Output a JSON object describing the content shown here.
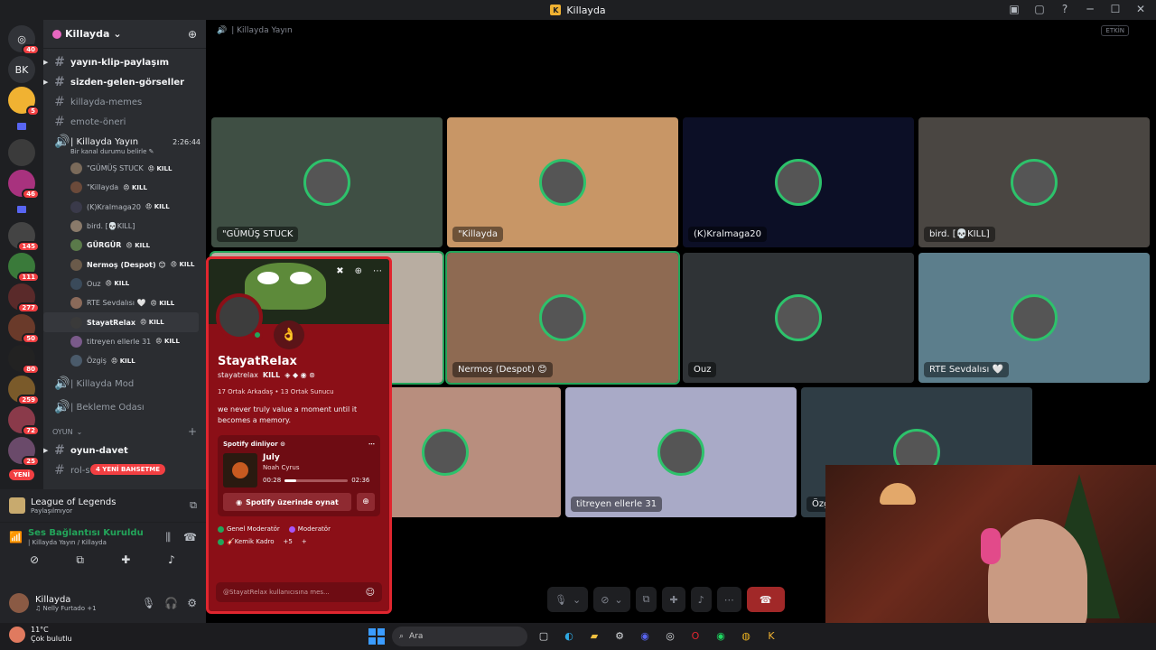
{
  "window": {
    "title": "Killayda",
    "controls": [
      "▣",
      "▢",
      "?",
      "─",
      "☐",
      "✕"
    ]
  },
  "rail": {
    "servers": [
      {
        "label": "◎",
        "badge": "40"
      },
      {
        "label": "BK",
        "badge": ""
      },
      {
        "label": "",
        "badge": "5",
        "color": "#f0b232"
      },
      {
        "label": "",
        "badge": "",
        "folder": true
      },
      {
        "label": "",
        "badge": "",
        "color": "#3b3b3b"
      },
      {
        "label": "",
        "badge": "46",
        "color": "#a8327e"
      },
      {
        "label": "",
        "badge": "",
        "folder": true
      },
      {
        "label": "",
        "badge": "145",
        "color": "#444"
      },
      {
        "label": "",
        "badge": "111",
        "color": "#3a7a3a"
      },
      {
        "label": "",
        "badge": "277",
        "color": "#5a2a2a"
      },
      {
        "label": "",
        "badge": "50",
        "color": "#6a3a2a"
      },
      {
        "label": "",
        "badge": "80",
        "color": "#222"
      },
      {
        "label": "",
        "badge": "259",
        "color": "#7a5a2a"
      },
      {
        "label": "",
        "badge": "72",
        "color": "#8a3a4a"
      },
      {
        "label": "",
        "badge": "25",
        "color": "#6a4a6a"
      }
    ],
    "new_label": "YENİ"
  },
  "guild": {
    "name": "Killayda",
    "channels": [
      {
        "name": "yayın-klip-paylaşım",
        "bold": true,
        "arrow": true
      },
      {
        "name": "sizden-gelen-görseller",
        "bold": true,
        "arrow": true
      },
      {
        "name": "killayda-memes",
        "bold": false
      },
      {
        "name": "emote-öneri",
        "bold": false
      }
    ],
    "voice_channel": {
      "name": "| Killayda Yayın",
      "time": "2:26:44",
      "status": "Bir kanal durumu belirle ✎"
    },
    "voice_users": [
      {
        "name": "\"GÜMÜŞ STUCK",
        "tag": "KILL",
        "bold": false
      },
      {
        "name": "\"Killayda",
        "tag": "KILL",
        "bold": false
      },
      {
        "name": "(K)Kralmaga20",
        "tag": "KILL",
        "bold": false
      },
      {
        "name": "bird. [💀KILL]",
        "tag": "",
        "bold": false
      },
      {
        "name": "GÜRGÜR",
        "tag": "KILL",
        "bold": true
      },
      {
        "name": "Nermoş (Despot) 😊",
        "tag": "KILL",
        "bold": true
      },
      {
        "name": "Ouz",
        "tag": "KILL",
        "bold": false
      },
      {
        "name": "RTE Sevdalısı 🤍",
        "tag": "KILL",
        "bold": false
      },
      {
        "name": "StayatRelax",
        "tag": "KILL",
        "bold": true,
        "hl": true
      },
      {
        "name": "titreyen ellerle 31",
        "tag": "KILL",
        "bold": false
      },
      {
        "name": "Özgiş",
        "tag": "KILL",
        "bold": false
      }
    ],
    "more_voice": [
      {
        "name": "| Killayda Mod"
      },
      {
        "name": "| Bekleme Odası"
      }
    ],
    "category": "OYUN",
    "category_channels": [
      {
        "name": "oyun-davet",
        "bold": true
      },
      {
        "name": "rol-s"
      }
    ],
    "new_mentions": "4 YENİ BAHSETME"
  },
  "activity": {
    "game": "League of Legends",
    "status": "Paylaşılmıyor"
  },
  "voice_panel": {
    "connected": "Ses Bağlantısı Kuruldu",
    "channel": "| Killayda Yayın / Killayda"
  },
  "user_panel": {
    "name": "Killayda",
    "status": "♫ Nelly Furtado +1"
  },
  "main": {
    "header": "| Killayda Yayın",
    "etkin": "ETKİN",
    "tiles": [
      {
        "name": "\"GÜMÜŞ STUCK",
        "bg": "#3f4f44"
      },
      {
        "name": "\"Killayda",
        "bg": "#c89666"
      },
      {
        "name": "(K)Kralmaga20",
        "bg": "#0c0f26"
      },
      {
        "name": "bird. [💀KILL]",
        "bg": "#4a4642"
      },
      {
        "name": "",
        "bg": "#b8ada1"
      },
      {
        "name": "Nermoş (Despot) 😊",
        "bg": "#8e6a52"
      },
      {
        "name": "Ouz",
        "bg": "#2f3336"
      },
      {
        "name": "RTE Sevdalısı 🤍",
        "bg": "#5c7e8c"
      },
      {
        "name": "",
        "bg": "#b88e7e"
      },
      {
        "name": "titreyen ellerle 31",
        "bg": "#a9aac7"
      },
      {
        "name": "Özg",
        "bg": "#2f3d45"
      }
    ]
  },
  "popup": {
    "display_name": "StayatRelax",
    "username": "stayatrelax",
    "tag": "KILL",
    "mutual": "17 Ortak Arkadaş • 13 Ortak Sunucu",
    "bio": "we never truly value a moment until it becomes a memory.",
    "spotify_head": "Spotify dinliyor ⊙",
    "song": "July",
    "artist": "Noah Cyrus",
    "elapsed": "00:28",
    "total": "02:36",
    "progress": 0.18,
    "play_label": "Spotify üzerinde oynat",
    "roles": [
      {
        "name": "Genel Moderatör",
        "color": "#23a55a"
      },
      {
        "name": "Moderatör",
        "color": "#a855f7"
      },
      {
        "name": "🎸Kemik Kadro",
        "color": "#23a55a"
      },
      {
        "name": "+5",
        "color": ""
      }
    ],
    "message_placeholder": "@StayatRelax kullanıcısına mes..."
  },
  "taskbar": {
    "temp": "11°C",
    "weather": "Çok bulutlu",
    "search": "Ara"
  }
}
